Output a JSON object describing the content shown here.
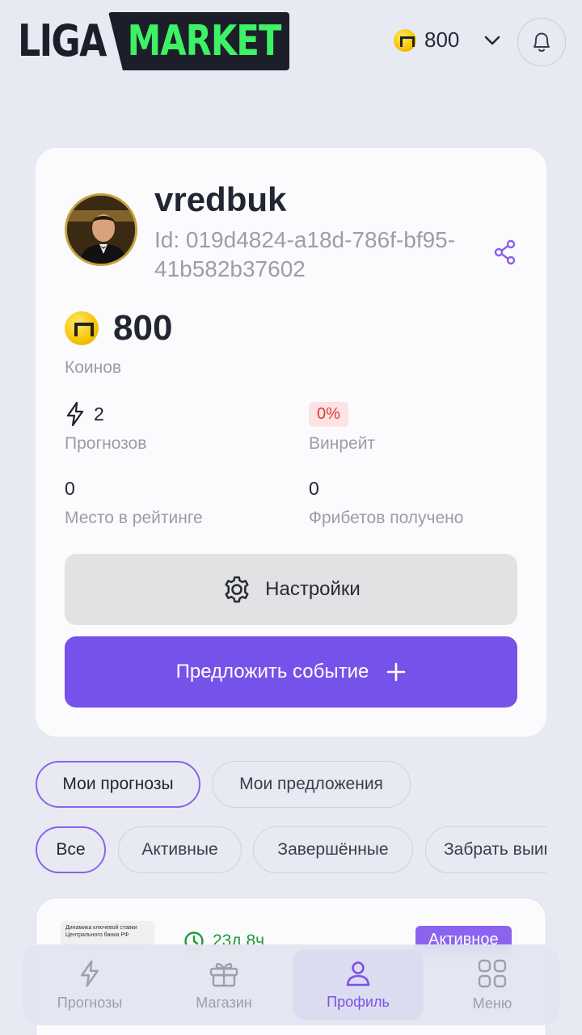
{
  "header": {
    "logo_left": "LIGA",
    "logo_right": "MARKET",
    "balance": "800"
  },
  "profile": {
    "username": "vredbuk",
    "id_text": "Id: 019d4824-a18d-786f-bf95-41b582b37602",
    "coins_value": "800",
    "coins_caption": "Коинов",
    "stats": {
      "predictions_value": "2",
      "predictions_caption": "Прогнозов",
      "winrate_value": "0%",
      "winrate_caption": "Винрейт",
      "rank_value": "0",
      "rank_caption": "Место в рейтинге",
      "freebets_value": "0",
      "freebets_caption": "Фрибетов получено"
    },
    "settings_label": "Настройки",
    "propose_label": "Предложить событие"
  },
  "tabs": {
    "my_predictions": "Мои прогнозы",
    "my_proposals": "Мои предложения"
  },
  "filters": {
    "all": "Все",
    "active": "Активные",
    "finished": "Завершённые",
    "claim": "Забрать выигрыш"
  },
  "prediction_card": {
    "thumb_text": "Динамика ключевой ставки Центрального банка РФ",
    "time_left": "23д 8ч",
    "status": "Активное"
  },
  "nav": {
    "predictions": "Прогнозы",
    "shop": "Магазин",
    "profile": "Профиль",
    "menu": "Меню"
  },
  "colors": {
    "accent": "#7752ea",
    "logo_green": "#3df265",
    "coin_yellow": "#f7c400",
    "winrate_red": "#e0393c",
    "timer_green": "#1f9a37"
  }
}
